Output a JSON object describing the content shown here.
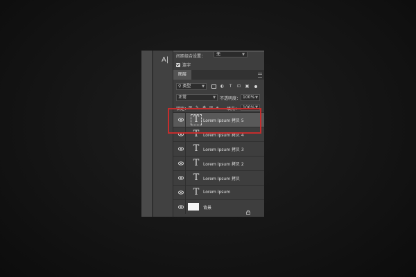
{
  "toolbar": {
    "type_tool_label": "A|"
  },
  "character_panel": {
    "aa_label": "间距组合设置：",
    "aa_value": "无",
    "checkbox_label": "连字"
  },
  "layers_panel": {
    "tab_label": "图层",
    "filter_kind": "类型",
    "blend_mode": "正常",
    "opacity_label": "不透明度：",
    "opacity_value": "100%",
    "lock_label": "锁定：",
    "fill_label": "填充：",
    "fill_value": "100%",
    "layers": [
      {
        "name": "Lorem Ipsum 拷贝 5",
        "kind": "text",
        "selected": true
      },
      {
        "name": "Lorem Ipsum 拷贝 4",
        "kind": "text",
        "selected": false
      },
      {
        "name": "Lorem Ipsum 拷贝 3",
        "kind": "text",
        "selected": false
      },
      {
        "name": "Lorem Ipsum 拷贝 2",
        "kind": "text",
        "selected": false
      },
      {
        "name": "Lorem Ipsum 拷贝",
        "kind": "text",
        "selected": false
      },
      {
        "name": "Lorem Ipsum",
        "kind": "text",
        "selected": false
      },
      {
        "name": "背景",
        "kind": "background",
        "selected": false
      }
    ]
  },
  "highlight_color": "#c62d2d"
}
